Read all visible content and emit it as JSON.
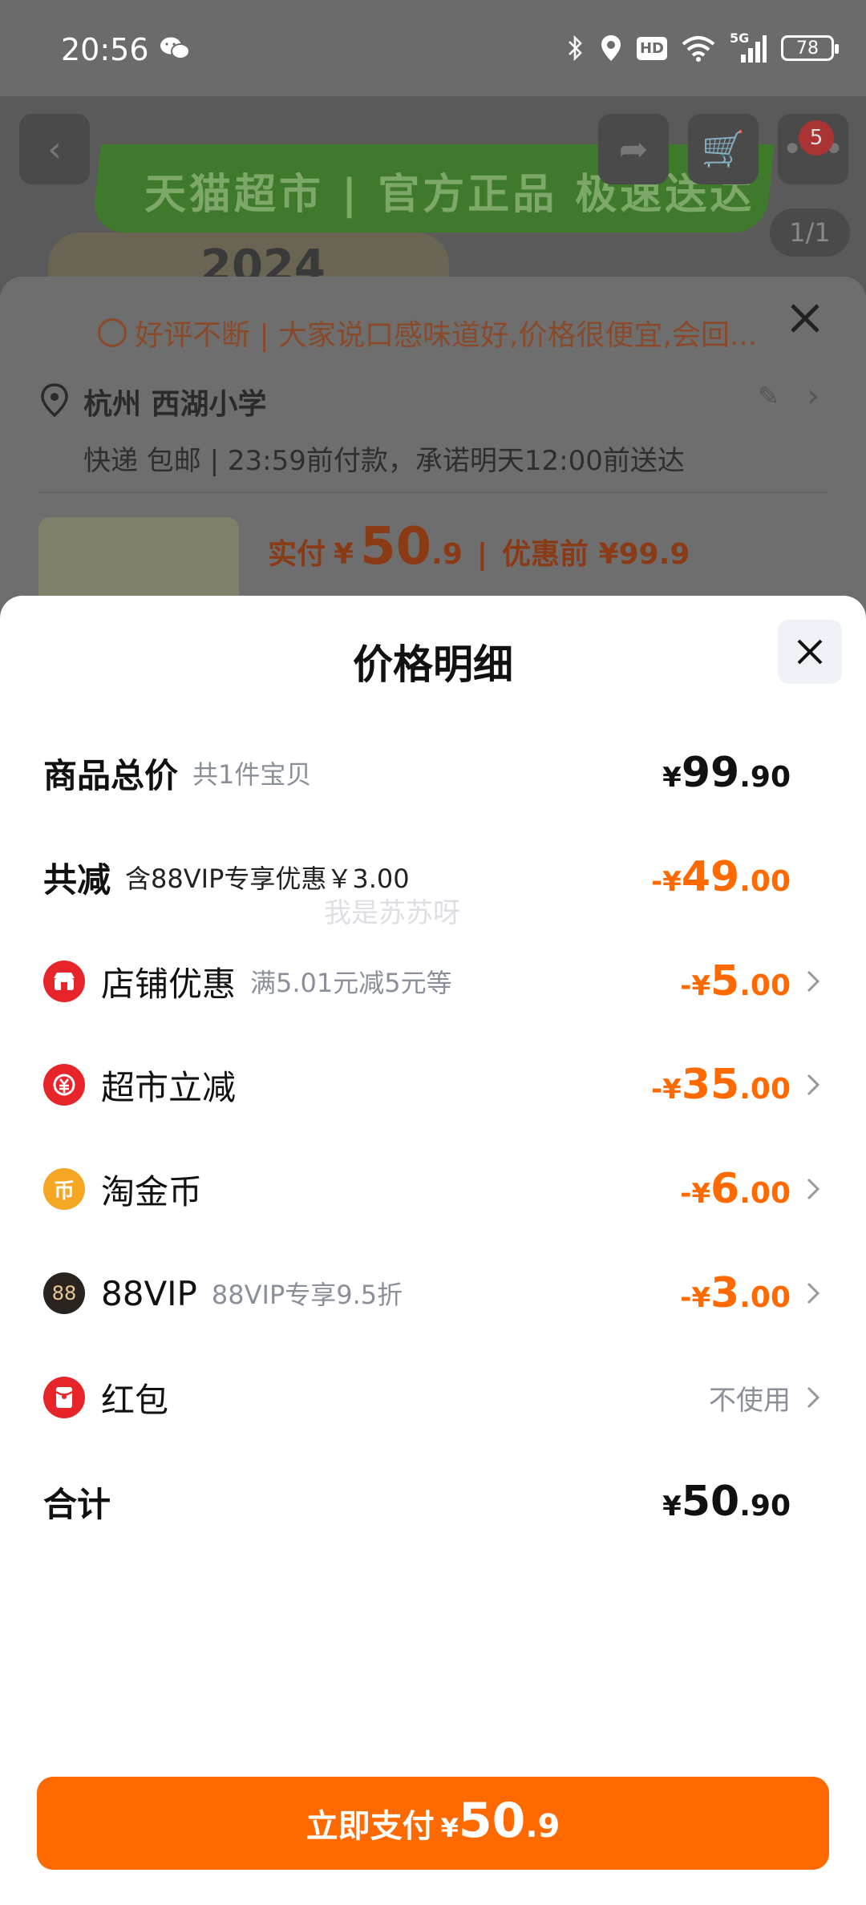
{
  "status": {
    "time": "20:56",
    "network": "5G",
    "hd": "HD",
    "battery": "78"
  },
  "background": {
    "banner_text": "天猫超市 | 官方正品 极速送达",
    "cart_badge": "5",
    "pager": "1/1",
    "product_year": "2024"
  },
  "order": {
    "tip": "好评不断 | 大家说口感味道好,价格很便宜,会回...",
    "address_title": "杭州 西湖小学",
    "delivery": "快递 包邮 | 23:59前付款，承诺明天12:00前送达",
    "pay_label": "实付",
    "pay_currency": "¥",
    "pay_int": "50",
    "pay_dec": ".9",
    "pre_label": "优惠前 ¥99.9"
  },
  "modal": {
    "title": "价格明细",
    "watermark": "我是苏苏呀",
    "rows": [
      {
        "label": "商品总价",
        "note": "共1件宝贝",
        "cur": "¥",
        "int": "99",
        "dec": ".90"
      },
      {
        "label": "共减",
        "note": "含88VIP专享优惠￥3.00",
        "cur": "-¥",
        "int": "49",
        "dec": ".00"
      },
      {
        "label": "店铺优惠",
        "note": "满5.01元减5元等",
        "cur": "-¥",
        "int": "5",
        "dec": ".00"
      },
      {
        "label": "超市立减",
        "note": "",
        "cur": "-¥",
        "int": "35",
        "dec": ".00"
      },
      {
        "label": "淘金币",
        "note": "",
        "cur": "-¥",
        "int": "6",
        "dec": ".00"
      },
      {
        "label": "88VIP",
        "note": "88VIP专享9.5折",
        "cur": "-¥",
        "int": "3",
        "dec": ".00"
      },
      {
        "label": "红包",
        "value": "不使用"
      },
      {
        "label": "合计",
        "cur": "¥",
        "int": "50",
        "dec": ".90"
      }
    ],
    "icons": {
      "shop": "store-icon",
      "market": "yuan-down-icon",
      "coin": "coin-icon",
      "vip": "88vip-icon",
      "redpacket": "red-envelope-icon"
    },
    "vip_icon_text": "88",
    "coin_icon_text": "币"
  },
  "pay_button": {
    "label": "立即支付",
    "currency": "¥",
    "int": "50",
    "dec": ".9"
  },
  "colors": {
    "accent": "#ff6a00",
    "red_icon": "#e8242b",
    "coin_icon": "#f5a623"
  }
}
